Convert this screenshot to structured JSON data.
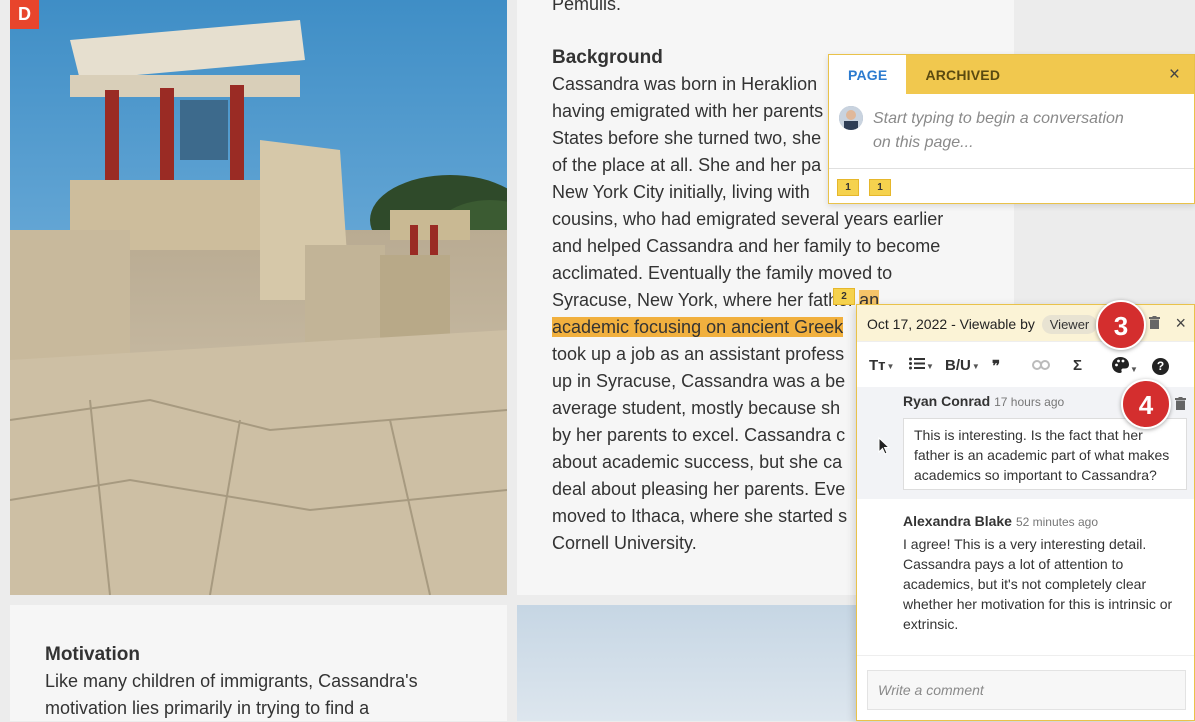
{
  "app": {
    "logo_letter": "D"
  },
  "article": {
    "top_fragment": "Pemulis.",
    "background_heading": "Background",
    "lines": [
      "Cassandra was born in Heraklion",
      "having emigrated with her parents",
      "States before she turned two, she",
      "of the place at all. She and her pa",
      "New York City initially, living with",
      "cousins, who had emigrated several years earlier",
      "and helped Cassandra and her family to become",
      "acclimated. Eventually the family moved to",
      "Syracuse, New York, where her father "
    ],
    "line8_highlight": "an",
    "line9_highlight": "academic focusing on ancient Greek",
    "lines_after": [
      "took up a job as an assistant profess",
      "up in Syracuse, Cassandra was a be",
      "average student, mostly because sh",
      "by her parents to excel. Cassandra c",
      "about academic success, but she ca",
      "deal about pleasing her parents. Eve",
      "moved to Ithaca, where she started s",
      "Cornell University."
    ],
    "inline_marker": "2"
  },
  "motivation": {
    "heading": "Motivation",
    "line1": "Like many children of immigrants, Cassandra's",
    "line2": "motivation lies primarily in trying to find a"
  },
  "page_panel": {
    "tab_page": "PAGE",
    "tab_archived": "ARCHIVED",
    "close_icon": "×",
    "placeholder": "Start typing to begin a conversation on this page...",
    "badges": [
      "1",
      "1"
    ]
  },
  "comment_panel": {
    "date": "Oct 17, 2022",
    "viewable_text": "- Viewable by",
    "viewer_chip": "Viewer",
    "close_icon": "×",
    "toolbar": {
      "text_size": "Tт",
      "bold_underline": "B/U",
      "quote": "❞",
      "link": "⊘",
      "sigma": "Σ",
      "help": "?"
    },
    "comments": [
      {
        "author": "Ryan Conrad",
        "time": "17 hours ago",
        "body": "This is interesting. Is the fact that her father is an academic part of what makes academics so important to Cassandra?"
      },
      {
        "author": "Alexandra Blake",
        "time": "52 minutes ago",
        "body": "I agree! This is a very interesting detail. Cassandra pays a lot of attention to academics, but it's not completely clear whether her motivation for this is intrinsic or extrinsic."
      }
    ],
    "write_placeholder": "Write a comment"
  },
  "steps": {
    "three": "3",
    "four": "4"
  }
}
